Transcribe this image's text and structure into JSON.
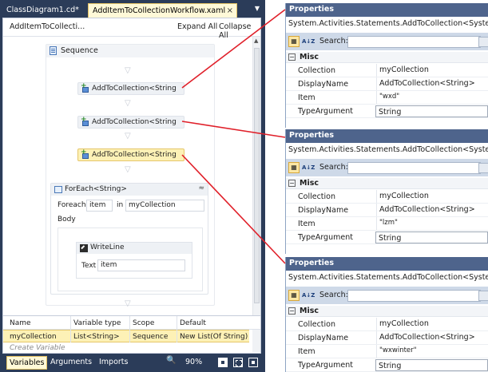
{
  "designer": {
    "tabs": [
      {
        "label": "ClassDiagram1.cd*"
      },
      {
        "label": "AddItemToCollectionWorkflow.xaml",
        "close": "×"
      }
    ],
    "tab_dropdown": "▼",
    "breadcrumb": "AddItemToCollecti...",
    "expand_all": "Expand All",
    "collapse_all": "Collapse All",
    "sequence_title": "Sequence",
    "chevron": "▽",
    "activities": [
      {
        "label": "AddToCollection<String"
      },
      {
        "label": "AddToCollection<String"
      },
      {
        "label": "AddToCollection<String"
      }
    ],
    "foreach": {
      "title": "ForEach<String>",
      "collapse": "≈",
      "foreach_label": "Foreach",
      "item_value": "item",
      "in_label": "in",
      "collection_value": "myCollection",
      "body_label": "Body",
      "writeline": {
        "title": "WriteLine",
        "text_label": "Text",
        "text_value": "item"
      }
    },
    "variables": {
      "headers": [
        "Name",
        "Variable type",
        "Scope",
        "Default"
      ],
      "row": [
        "myCollection",
        "List<String>",
        "Sequence",
        "New List(Of String)"
      ],
      "create": "Create Variable"
    },
    "bottom": {
      "variables": "Variables",
      "arguments": "Arguments",
      "imports": "Imports",
      "zoom_icon": "🔍",
      "zoom": "90%"
    }
  },
  "properties": [
    {
      "title": "Properties",
      "type_name": "System.Activities.Statements.AddToCollection<System.Stri",
      "search_label": "Search:",
      "category": "Misc",
      "toggle": "−",
      "rows": [
        {
          "name": "Collection",
          "value": "myCollection"
        },
        {
          "name": "DisplayName",
          "value": "AddToCollection<String>"
        },
        {
          "name": "Item",
          "value": "\"wxd\""
        },
        {
          "name": "TypeArgument",
          "value": "String"
        }
      ]
    },
    {
      "title": "Properties",
      "type_name": "System.Activities.Statements.AddToCollection<System.Stri",
      "search_label": "Search:",
      "category": "Misc",
      "toggle": "−",
      "rows": [
        {
          "name": "Collection",
          "value": "myCollection"
        },
        {
          "name": "DisplayName",
          "value": "AddToCollection<String>"
        },
        {
          "name": "Item",
          "value": "\"lzm\""
        },
        {
          "name": "TypeArgument",
          "value": "String"
        }
      ]
    },
    {
      "title": "Properties",
      "type_name": "System.Activities.Statements.AddToCollection<System.Stri",
      "search_label": "Search:",
      "category": "Misc",
      "toggle": "−",
      "rows": [
        {
          "name": "Collection",
          "value": "myCollection"
        },
        {
          "name": "DisplayName",
          "value": "AddToCollection<String>"
        },
        {
          "name": "Item",
          "value": "\"wxwinter\""
        },
        {
          "name": "TypeArgument",
          "value": "String"
        }
      ]
    }
  ],
  "colors": {
    "chrome": "#2b3c59",
    "selected": "#fdf1b6",
    "properties_title": "#4e648c",
    "connector": "#e0202a"
  }
}
